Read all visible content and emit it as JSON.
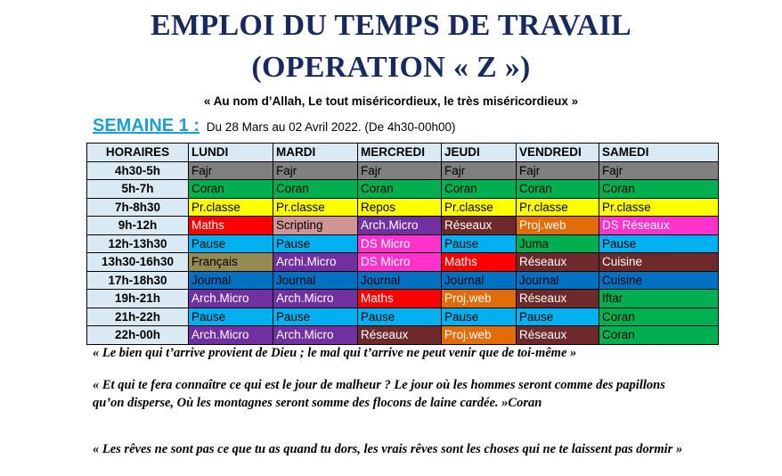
{
  "title_line1": "EMPLOI DU TEMPS DE TRAVAIL",
  "title_line2": "(OPERATION « Z »)",
  "invocation": "« Au nom d’Allah, Le tout miséricordieux, le très miséricordieux »",
  "week": {
    "label": "SEMAINE 1 :",
    "range": "Du 28 Mars au 02 Avril 2022.  (De 4h30-00h00)"
  },
  "colors": {
    "gray": "#808080",
    "green": "#00b050",
    "yellow": "#ffff00",
    "red": "#ff0000",
    "rose": "#d09494",
    "purple": "#7030a0",
    "maroon": "#6e2a2a",
    "orange": "#e36c0a",
    "magenta": "#ff33cc",
    "cyan": "#00b0f0",
    "olive": "#948a54",
    "blue": "#0070c0",
    "header": "#d9eaf4"
  },
  "table": {
    "headers": [
      "HORAIRES",
      "LUNDI",
      "MARDI",
      "MERCREDI",
      "JEUDI",
      "VENDREDI",
      "SAMEDI"
    ],
    "rows": [
      {
        "hour": "4h30-5h",
        "cells": [
          {
            "text": "Fajr",
            "color": "gray"
          },
          {
            "text": "Fajr",
            "color": "gray"
          },
          {
            "text": "Fajr",
            "color": "gray"
          },
          {
            "text": "Fajr",
            "color": "gray"
          },
          {
            "text": "Fajr",
            "color": "gray"
          },
          {
            "text": "Fajr",
            "color": "gray"
          }
        ]
      },
      {
        "hour": "5h-7h",
        "cells": [
          {
            "text": "Coran",
            "color": "green"
          },
          {
            "text": "Coran",
            "color": "green"
          },
          {
            "text": "Coran",
            "color": "green"
          },
          {
            "text": "Coran",
            "color": "green"
          },
          {
            "text": "Coran",
            "color": "green"
          },
          {
            "text": "Coran",
            "color": "green"
          }
        ]
      },
      {
        "hour": "7h-8h30",
        "cells": [
          {
            "text": "Pr.classe",
            "color": "yellow"
          },
          {
            "text": "Pr.classe",
            "color": "yellow"
          },
          {
            "text": "Repos",
            "color": "yellow"
          },
          {
            "text": "Pr.classe",
            "color": "yellow"
          },
          {
            "text": "Pr.classe",
            "color": "yellow"
          },
          {
            "text": "Pr.classe",
            "color": "yellow"
          }
        ]
      },
      {
        "hour": "9h-12h",
        "cells": [
          {
            "text": "Maths",
            "color": "red"
          },
          {
            "text": "Scripting",
            "color": "rose"
          },
          {
            "text": "Arch.Micro",
            "color": "purple"
          },
          {
            "text": "Réseaux",
            "color": "maroon"
          },
          {
            "text": "Proj.web",
            "color": "orange"
          },
          {
            "text": "DS Réseaux",
            "color": "magenta"
          }
        ]
      },
      {
        "hour": "12h-13h30",
        "cells": [
          {
            "text": "Pause",
            "color": "cyan"
          },
          {
            "text": "Pause",
            "color": "cyan"
          },
          {
            "text": "DS Micro",
            "color": "magenta"
          },
          {
            "text": "Pause",
            "color": "cyan"
          },
          {
            "text": "Juma",
            "color": "green"
          },
          {
            "text": "Pause",
            "color": "cyan"
          }
        ]
      },
      {
        "hour": "13h30-16h30",
        "cells": [
          {
            "text": "Français",
            "color": "olive"
          },
          {
            "text": "Archi.Micro",
            "color": "purple"
          },
          {
            "text": "DS Micro",
            "color": "magenta"
          },
          {
            "text": "Maths",
            "color": "red"
          },
          {
            "text": "Réseaux",
            "color": "maroon"
          },
          {
            "text": "Cuisine",
            "color": "maroon"
          }
        ]
      },
      {
        "hour": "17h-18h30",
        "cells": [
          {
            "text": "Journal",
            "color": "blue"
          },
          {
            "text": "Journal",
            "color": "blue"
          },
          {
            "text": "Journal",
            "color": "blue"
          },
          {
            "text": "Journal",
            "color": "blue"
          },
          {
            "text": "Journal",
            "color": "blue"
          },
          {
            "text": "Cuisine",
            "color": "blue"
          }
        ]
      },
      {
        "hour": "19h-21h",
        "cells": [
          {
            "text": "Arch.Micro",
            "color": "purple"
          },
          {
            "text": "Arch.Micro",
            "color": "purple"
          },
          {
            "text": "Maths",
            "color": "red"
          },
          {
            "text": "Proj.web",
            "color": "orange"
          },
          {
            "text": "Réseaux",
            "color": "maroon"
          },
          {
            "text": "Iftar",
            "color": "green"
          }
        ]
      },
      {
        "hour": "21h-22h",
        "cells": [
          {
            "text": "Pause",
            "color": "cyan"
          },
          {
            "text": "Pause",
            "color": "cyan"
          },
          {
            "text": "Pause",
            "color": "cyan"
          },
          {
            "text": "Pause",
            "color": "cyan"
          },
          {
            "text": "Pause",
            "color": "cyan"
          },
          {
            "text": "Coran",
            "color": "green"
          }
        ]
      },
      {
        "hour": "22h-00h",
        "cells": [
          {
            "text": "Arch.Micro",
            "color": "purple"
          },
          {
            "text": "Arch.Micro",
            "color": "purple"
          },
          {
            "text": "Réseaux",
            "color": "maroon"
          },
          {
            "text": "Proj.web",
            "color": "orange"
          },
          {
            "text": "Réseaux",
            "color": "maroon"
          },
          {
            "text": "Coran",
            "color": "green"
          }
        ]
      }
    ]
  },
  "quotes": [
    "« Le bien qui t’arrive provient de Dieu ; le mal qui t’arrive ne peut venir que de toi-même »",
    "« Et qui te fera connaître  ce qui est le jour de malheur ? Le jour où les hommes seront comme des papillons qu’on disperse,  Où les montagnes seront somme des flocons de laine cardée. »Coran",
    "« Les rêves ne sont pas ce que tu as quand tu dors, les vrais rêves sont  les choses qui ne te laissent  pas dormir »"
  ]
}
